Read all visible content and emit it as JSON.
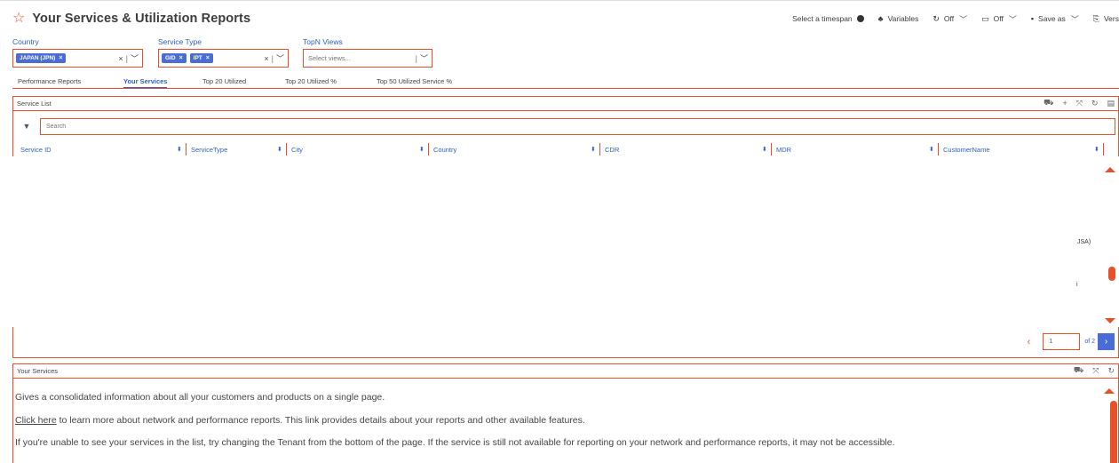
{
  "header": {
    "title": "Your Services & Utilization Reports",
    "star_icon": "star-icon",
    "timespan_label": "Select a timespan",
    "variables_label": "Variables",
    "refresh1_label": "Off",
    "display_label": "Off",
    "save_label": "Save as",
    "version_label": "Vers"
  },
  "filters": {
    "country": {
      "label": "Country",
      "chips": [
        "JAPAN (JPN)"
      ]
    },
    "service_type": {
      "label": "Service Type",
      "chips": [
        "GID",
        "IPT"
      ]
    },
    "topn": {
      "label": "TopN Views",
      "placeholder": "Select views..."
    }
  },
  "tabs": [
    "Performance Reports",
    "Your Services",
    "Top 20 Utilized",
    "Top 20 Utilized %",
    "Top 50 Utilized Service %"
  ],
  "active_tab": "Your Services",
  "service_list": {
    "title": "Service List",
    "search_placeholder": "Search",
    "columns": [
      "Service ID",
      "ServiceType",
      "City",
      "Country",
      "CDR",
      "MDR",
      "CustomerName"
    ],
    "stray_text": "JSA)",
    "stray_mark": "i",
    "pager": {
      "current": "1",
      "of_label": "of 2"
    }
  },
  "your_services": {
    "title": "Your Services",
    "line1": "Gives a consolidated information about all your customers and products on a single page.",
    "link_text": "Click here",
    "line2_rest": " to learn more about network and performance reports. This link provides details about your reports and other available features.",
    "line3": "If you're unable to see your services in the list, try changing the Tenant from the bottom of the page. If the service is still not available for reporting on your network and performance reports, it may not be accessible."
  },
  "colors": {
    "accent": "#e8502a",
    "link": "#2b5fc2",
    "chip": "#4a6cd4"
  }
}
